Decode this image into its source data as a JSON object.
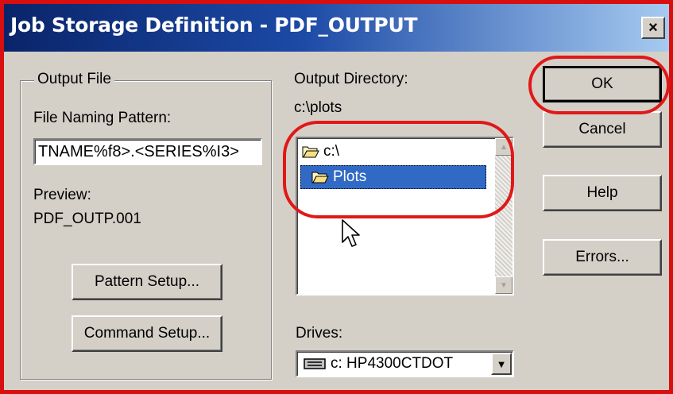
{
  "window": {
    "title": "Job Storage Definition - PDF_OUTPUT",
    "close_glyph": "×"
  },
  "output_file": {
    "legend": "Output File",
    "naming_label": "File Naming Pattern:",
    "naming_value": "TNAME%f8>.<SERIES%I3>",
    "preview_label": "Preview:",
    "preview_value": "PDF_OUTP.001",
    "pattern_setup": "Pattern Setup...",
    "command_setup": "Command Setup..."
  },
  "output_directory": {
    "label": "Output Directory:",
    "current_path": "c:\\plots",
    "items": [
      {
        "label": "c:\\",
        "icon": "open-folder-icon",
        "selected": false
      },
      {
        "label": "Plots",
        "icon": "open-folder-icon",
        "selected": true
      }
    ]
  },
  "drives": {
    "label": "Drives:",
    "value": "c: HP4300CTDOT",
    "icon": "drive-icon"
  },
  "buttons": {
    "ok": "OK",
    "cancel": "Cancel",
    "help": "Help",
    "errors": "Errors..."
  },
  "colors": {
    "annotation": "#e01818",
    "selection": "#316ac5",
    "dialog_face": "#d4d0c8"
  }
}
